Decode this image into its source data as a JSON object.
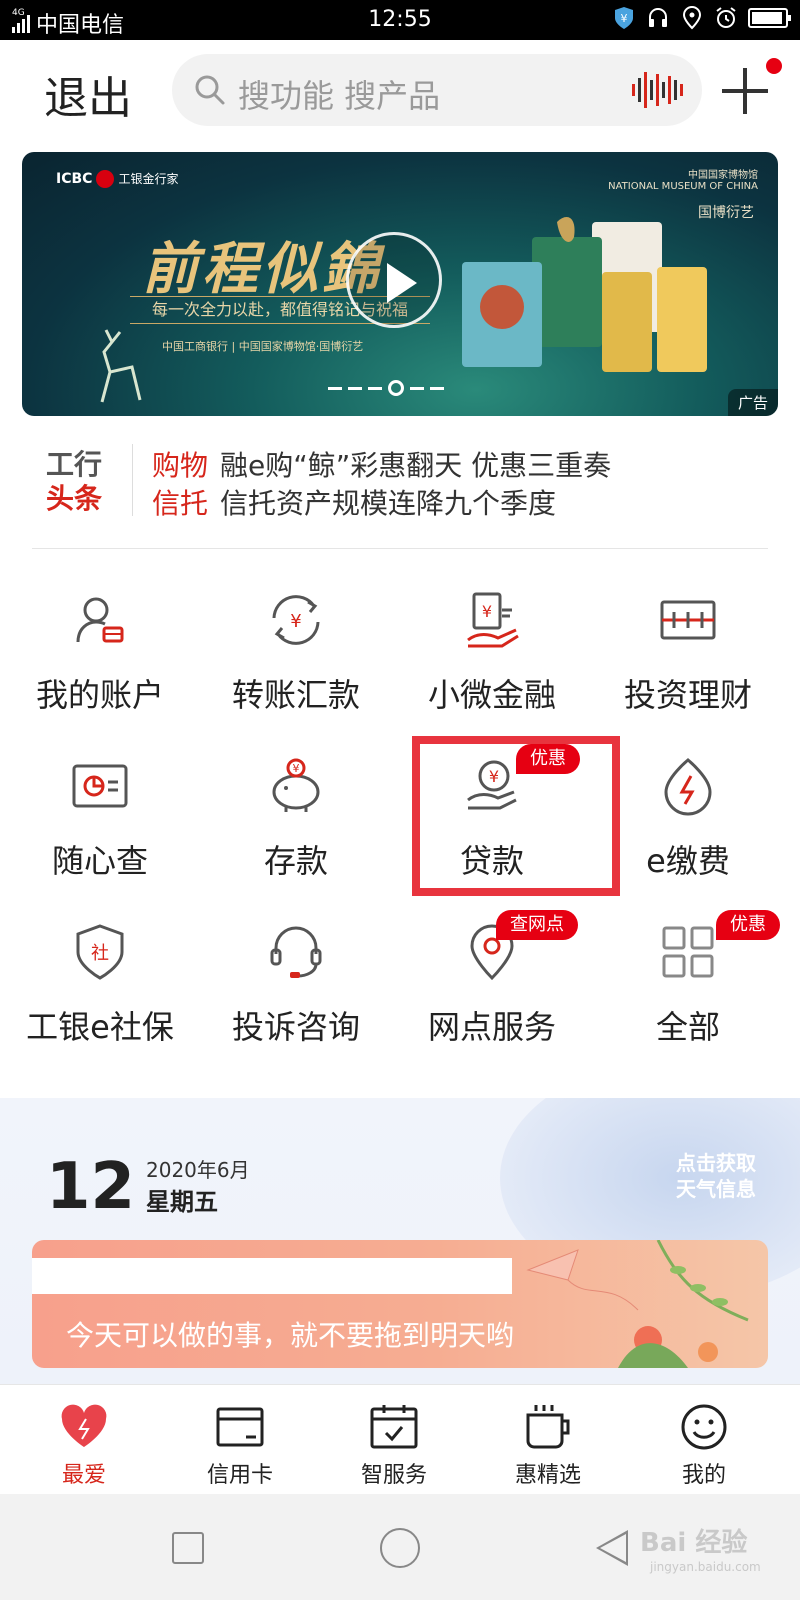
{
  "status_bar": {
    "network": "4G",
    "carrier": "中国电信",
    "time": "12:55"
  },
  "header": {
    "exit_label": "退出",
    "search_placeholder": "搜功能 搜产品",
    "icons": [
      "search-icon",
      "voice-wave-icon",
      "plus-icon"
    ]
  },
  "banner": {
    "brand": "ICBC",
    "brand_sub": "工银金行家",
    "museum_name": "中国国家博物馆",
    "museum_en": "NATIONAL MUSEUM OF CHINA",
    "museum_mark": "国博衍艺",
    "headline": "前程似錦",
    "slogan": "每一次全力以赴，都值得铭记与祝福",
    "partners": "中国工商银行 | 中国国家博物馆·国博衍艺",
    "ad_label": "广告",
    "slide_count": 6,
    "active_slide": 4
  },
  "news": {
    "logo_line1": "工行",
    "logo_line2": "头条",
    "items": [
      {
        "tag": "购物",
        "text": "融e购“鲸”彩惠翻天 优惠三重奏"
      },
      {
        "tag": "信托",
        "text": "信托资产规模连降九个季度"
      }
    ]
  },
  "services": [
    {
      "label": "我的账户",
      "icon": "account-icon"
    },
    {
      "label": "转账汇款",
      "icon": "transfer-icon"
    },
    {
      "label": "小微金融",
      "icon": "micro-finance-icon"
    },
    {
      "label": "投资理财",
      "icon": "investment-icon"
    },
    {
      "label": "随心查",
      "icon": "query-icon"
    },
    {
      "label": "存款",
      "icon": "piggy-bank-icon"
    },
    {
      "label": "贷款",
      "icon": "loan-icon",
      "badge": "优惠"
    },
    {
      "label": "e缴费",
      "icon": "payment-icon"
    },
    {
      "label": "工银e社保",
      "icon": "social-security-icon"
    },
    {
      "label": "投诉咨询",
      "icon": "headset-icon"
    },
    {
      "label": "网点服务",
      "icon": "location-icon",
      "badge": "查网点"
    },
    {
      "label": "全部",
      "icon": "grid-icon",
      "badge": "优惠"
    }
  ],
  "weather": {
    "day": "12",
    "year_month": "2020年6月",
    "weekday": "星期五",
    "hint_line1": "点击获取",
    "hint_line2": "天气信息",
    "quote": "今天可以做的事，就不要拖到明天哟"
  },
  "tabbar": [
    {
      "label": "最爱",
      "icon": "heart-icon",
      "active": true
    },
    {
      "label": "信用卡",
      "icon": "credit-card-icon"
    },
    {
      "label": "智服务",
      "icon": "calendar-check-icon"
    },
    {
      "label": "惠精选",
      "icon": "coffee-cup-icon"
    },
    {
      "label": "我的",
      "icon": "smiley-icon"
    }
  ],
  "watermark": {
    "text": "Bai 经验",
    "url": "jingyan.baidu.com"
  },
  "colors": {
    "brand_red": "#e60012",
    "highlight_box": "#e8343e",
    "icon_stroke": "#555555"
  }
}
